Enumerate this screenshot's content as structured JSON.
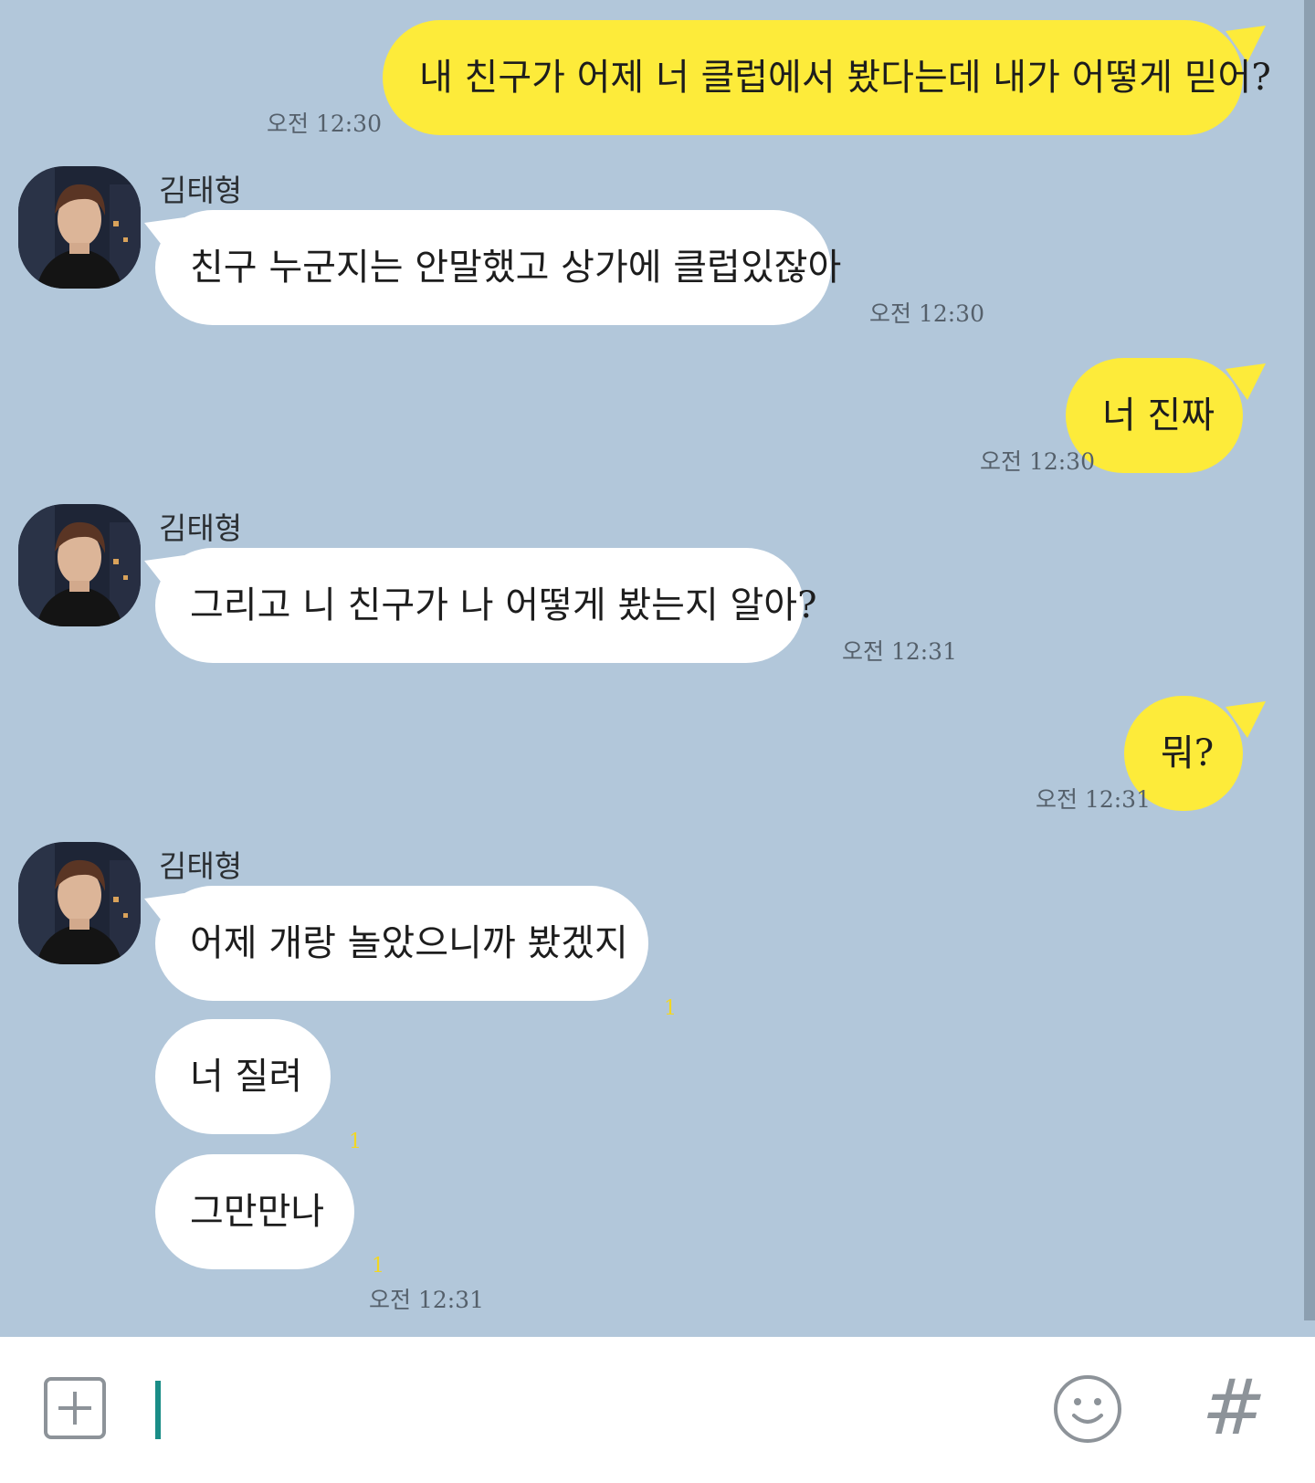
{
  "messages": [
    {
      "sender": "me",
      "text": "내 친구가 어제 너 클럽에서 봤다는데 내가 어떻게 믿어?",
      "time": "오전 12:30"
    },
    {
      "sender": "other",
      "name": "김태형",
      "text": "친구 누군지는 안말했고 상가에 클럽있잖아",
      "time": "오전 12:30"
    },
    {
      "sender": "me",
      "text": "너 진짜",
      "time": "오전 12:30"
    },
    {
      "sender": "other",
      "name": "김태형",
      "text": "그리고 니 친구가 나 어떻게 봤는지 알아?",
      "time": "오전 12:31"
    },
    {
      "sender": "me",
      "text": "뭐?",
      "time": "오전 12:31"
    },
    {
      "sender": "other",
      "name": "김태형",
      "text": "어제 개랑 놀았으니까 봤겠지",
      "unread": "1"
    },
    {
      "sender": "other",
      "text": "너 질려",
      "unread": "1"
    },
    {
      "sender": "other",
      "text": "그만만나",
      "unread": "1",
      "time": "오전 12:31"
    }
  ],
  "input": {
    "value": "",
    "plus_icon": "plus-square-icon",
    "emoji_icon": "smiley-icon",
    "hash_label": "#"
  },
  "colors": {
    "background": "#b2c7da",
    "my_bubble": "#fdeb3a",
    "other_bubble": "#ffffff",
    "unread": "#f2d723",
    "cursor": "#1a8d87"
  }
}
